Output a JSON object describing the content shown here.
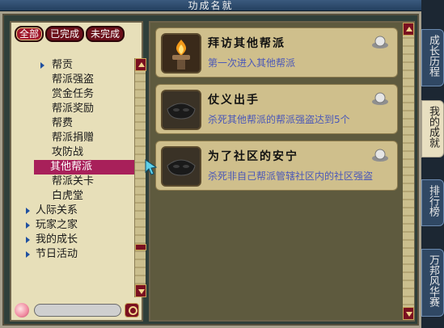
{
  "window": {
    "title": "功成名就"
  },
  "filters": [
    {
      "label": "全部",
      "active": true
    },
    {
      "label": "已完成",
      "active": false
    },
    {
      "label": "未完成",
      "active": false
    }
  ],
  "tree": {
    "children": [
      {
        "label": "帮贡",
        "arrow": true
      },
      {
        "label": "帮派强盗"
      },
      {
        "label": "赏金任务"
      },
      {
        "label": "帮派奖励"
      },
      {
        "label": "帮费"
      },
      {
        "label": "帮派捐赠"
      },
      {
        "label": "攻防战"
      },
      {
        "label": "其他帮派",
        "selected": true
      },
      {
        "label": "帮派关卡"
      },
      {
        "label": "白虎堂"
      }
    ],
    "top": [
      {
        "label": "人际关系"
      },
      {
        "label": "玩家之家"
      },
      {
        "label": "我的成长"
      },
      {
        "label": "节日活动"
      }
    ]
  },
  "achievements": [
    {
      "title": "拜访其他帮派",
      "desc": "第一次进入其他帮派",
      "icon": "torch-icon"
    },
    {
      "title": "仗义出手",
      "desc": "杀死其他帮派的帮派强盗达到5个",
      "icon": "bandit-mask-icon"
    },
    {
      "title": "为了社区的安宁",
      "desc": "杀死非自己帮派管辖社区内的社区强盗",
      "icon": "bandit-mask-icon"
    }
  ],
  "tabs": [
    {
      "label": "成长历程"
    },
    {
      "label": "我的成就",
      "active": true
    },
    {
      "label": "排行榜"
    },
    {
      "label": "万邦风华赛"
    }
  ]
}
